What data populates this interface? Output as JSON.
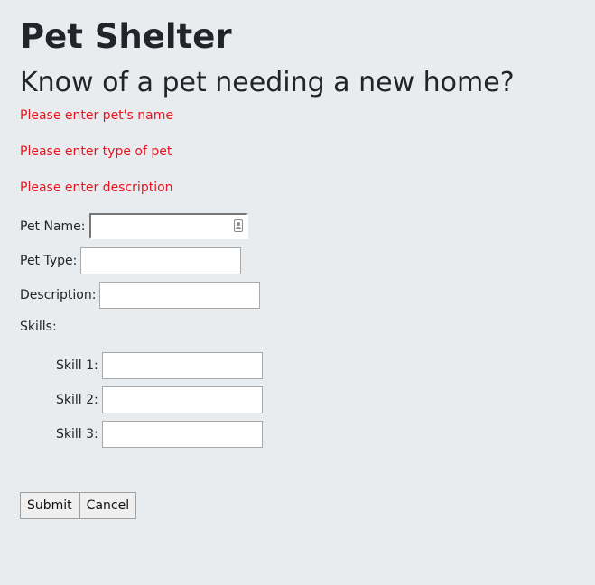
{
  "page": {
    "title": "Pet Shelter",
    "subtitle": "Know of a pet needing a new home?"
  },
  "errors": {
    "name": "Please enter pet's name",
    "type": "Please enter type of pet",
    "description": "Please enter description"
  },
  "form": {
    "name_label": "Pet Name:",
    "name_value": "",
    "type_label": "Pet Type:",
    "type_value": "",
    "description_label": "Description:",
    "description_value": "",
    "skills_label": "Skills:",
    "skill1_label": "Skill 1:",
    "skill1_value": "",
    "skill2_label": "Skill 2:",
    "skill2_value": "",
    "skill3_label": "Skill 3:",
    "skill3_value": "",
    "submit_label": "Submit",
    "cancel_label": "Cancel"
  },
  "icons": {
    "name_field_icon": "contact-card-icon"
  },
  "colors": {
    "background": "#e9ecef",
    "error": "#e8131e",
    "text": "#212529"
  }
}
